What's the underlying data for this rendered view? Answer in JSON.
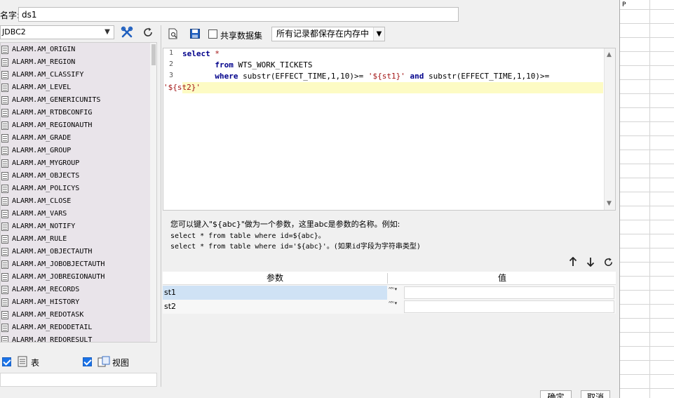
{
  "name_row": {
    "label": "名字:",
    "value": "ds1"
  },
  "left_panel": {
    "connection": "JDBC2",
    "tables": [
      "ALARM.AM_ORIGIN",
      "ALARM.AM_REGION",
      "ALARM.AM_CLASSIFY",
      "ALARM.AM_LEVEL",
      "ALARM.AM_GENERICUNITS",
      "ALARM.AM_RTDBCONFIG",
      "ALARM.AM_REGIONAUTH",
      "ALARM.AM_GRADE",
      "ALARM.AM_GROUP",
      "ALARM.AM_MYGROUP",
      "ALARM.AM_OBJECTS",
      "ALARM.AM_POLICYS",
      "ALARM.AM_CLOSE",
      "ALARM.AM_VARS",
      "ALARM.AM_NOTIFY",
      "ALARM.AM_RULE",
      "ALARM.AM_OBJECTAUTH",
      "ALARM.AM_JOBOBJECTAUTH",
      "ALARM.AM_JOBREGIONAUTH",
      "ALARM.AM_RECORDS",
      "ALARM.AM_HISTORY",
      "ALARM.AM_REDOTASK",
      "ALARM.AM_REDODETAIL",
      "ALARM.AM_REDORESULT"
    ],
    "filter_table_label": "表",
    "filter_view_label": "视图"
  },
  "toolbar": {
    "shared_dataset_label": "共享数据集",
    "memory_mode": "所有记录都保存在内存中"
  },
  "editor": {
    "line_numbers": [
      "1",
      "2",
      "3"
    ],
    "l1_select": "select",
    "l1_star": " *",
    "l2_indent": "       ",
    "l2_from": "from",
    "l2_table": " WTS_WORK_TICKETS",
    "l3_where": "where",
    "l3_func1": " substr(EFFECT_TIME,1,10)>= ",
    "l3_str1": "'${st1}'",
    "l3_and": "and",
    "l3_func2": " substr(EFFECT_TIME,1,10)>=",
    "l4_str2": "'${st2}'"
  },
  "help": {
    "line1": "您可以键入\"${abc}\"做为一个参数，这里abc是参数的名称。例如:",
    "line2": "select * from table where id=${abc}。",
    "line3": "select * from table where id='${abc}'。(如果id字段为字符串类型)"
  },
  "params": {
    "header_name": "参数",
    "header_value": "值",
    "type_glyph_top": "ᴬᴮᶜ",
    "rows": [
      {
        "name": "st1",
        "value": ""
      },
      {
        "name": "st2",
        "value": ""
      }
    ]
  },
  "buttons": {
    "ok": "确定",
    "cancel": "取消"
  },
  "sheet": {
    "col_header": "P"
  },
  "colors": {
    "accent": "#1a73e8",
    "highlight_line": "#fdfbc4",
    "tree_bg": "#e9e4ea",
    "selected_row": "#cfe2f5"
  }
}
